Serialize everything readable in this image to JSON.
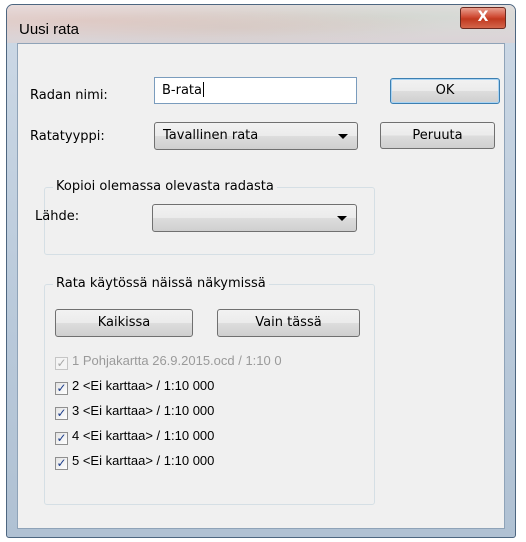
{
  "window": {
    "title": "Uusi rata",
    "close_glyph": "X"
  },
  "form": {
    "name_label": "Radan nimi:",
    "name_value": "B-rata",
    "type_label": "Ratatyyppi:",
    "type_value": "Tavallinen rata",
    "copy_group_title": "Kopioi olemassa olevasta radasta",
    "source_label": "Lähde:",
    "source_value": ""
  },
  "buttons": {
    "ok": "OK",
    "cancel": "Peruuta"
  },
  "views": {
    "group_title": "Rata käytössä näissä näkymissä",
    "all_button": "Kaikissa",
    "only_this_button": "Vain tässä",
    "items": [
      {
        "label": "1 Pohjakartta 26.9.2015.ocd  / 1:10 0",
        "checked": true,
        "disabled": true
      },
      {
        "label": "2 <Ei karttaa>  / 1:10 000",
        "checked": true,
        "disabled": false
      },
      {
        "label": "3 <Ei karttaa>  / 1:10 000",
        "checked": true,
        "disabled": false
      },
      {
        "label": "4 <Ei karttaa>  / 1:10 000",
        "checked": true,
        "disabled": false
      },
      {
        "label": "5 <Ei karttaa>  / 1:10 000",
        "checked": true,
        "disabled": false
      }
    ]
  },
  "colors": {
    "default_button_border": "#3c7fb1",
    "checkmark": "#1b3c8a",
    "close_button": "#c0391f"
  }
}
